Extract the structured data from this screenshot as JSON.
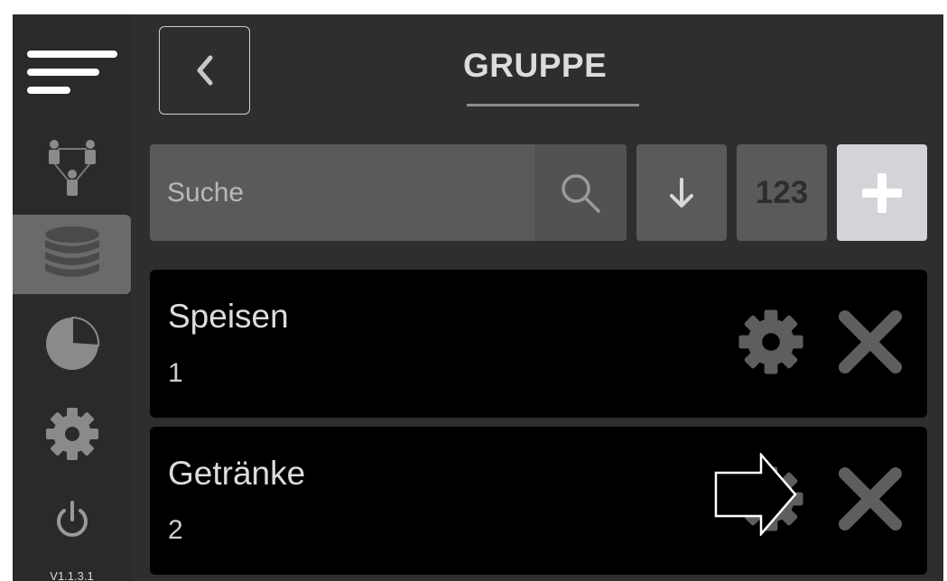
{
  "app": {
    "title": "GRUPPE",
    "version": "V1.1.3.1"
  },
  "sidebar": {
    "items": [
      {
        "name": "menu",
        "icon": "hamburger-menu-icon"
      },
      {
        "name": "users",
        "icon": "users-network-icon"
      },
      {
        "name": "groups",
        "icon": "database-stack-icon",
        "active": true
      },
      {
        "name": "statistics",
        "icon": "pie-chart-icon"
      },
      {
        "name": "settings",
        "icon": "gear-icon"
      },
      {
        "name": "power",
        "icon": "power-icon"
      }
    ]
  },
  "toolbar": {
    "search_placeholder": "Suche",
    "search_value": "",
    "numeric_sort_label": "123",
    "sort_icon": "arrow-down-icon",
    "add_icon": "plus-icon"
  },
  "groups": [
    {
      "name": "Speisen",
      "count": "1"
    },
    {
      "name": "Getränke",
      "count": "2"
    }
  ],
  "colors": {
    "background": "#2e2e2e",
    "sidebar": "#2a2a2a",
    "active_item": "#6a6a6a",
    "button": "#5a5a5a",
    "add_button": "#d4d4d8",
    "row": "#000000",
    "icon": "#5e5e5e",
    "text": "#dcdcdc"
  }
}
